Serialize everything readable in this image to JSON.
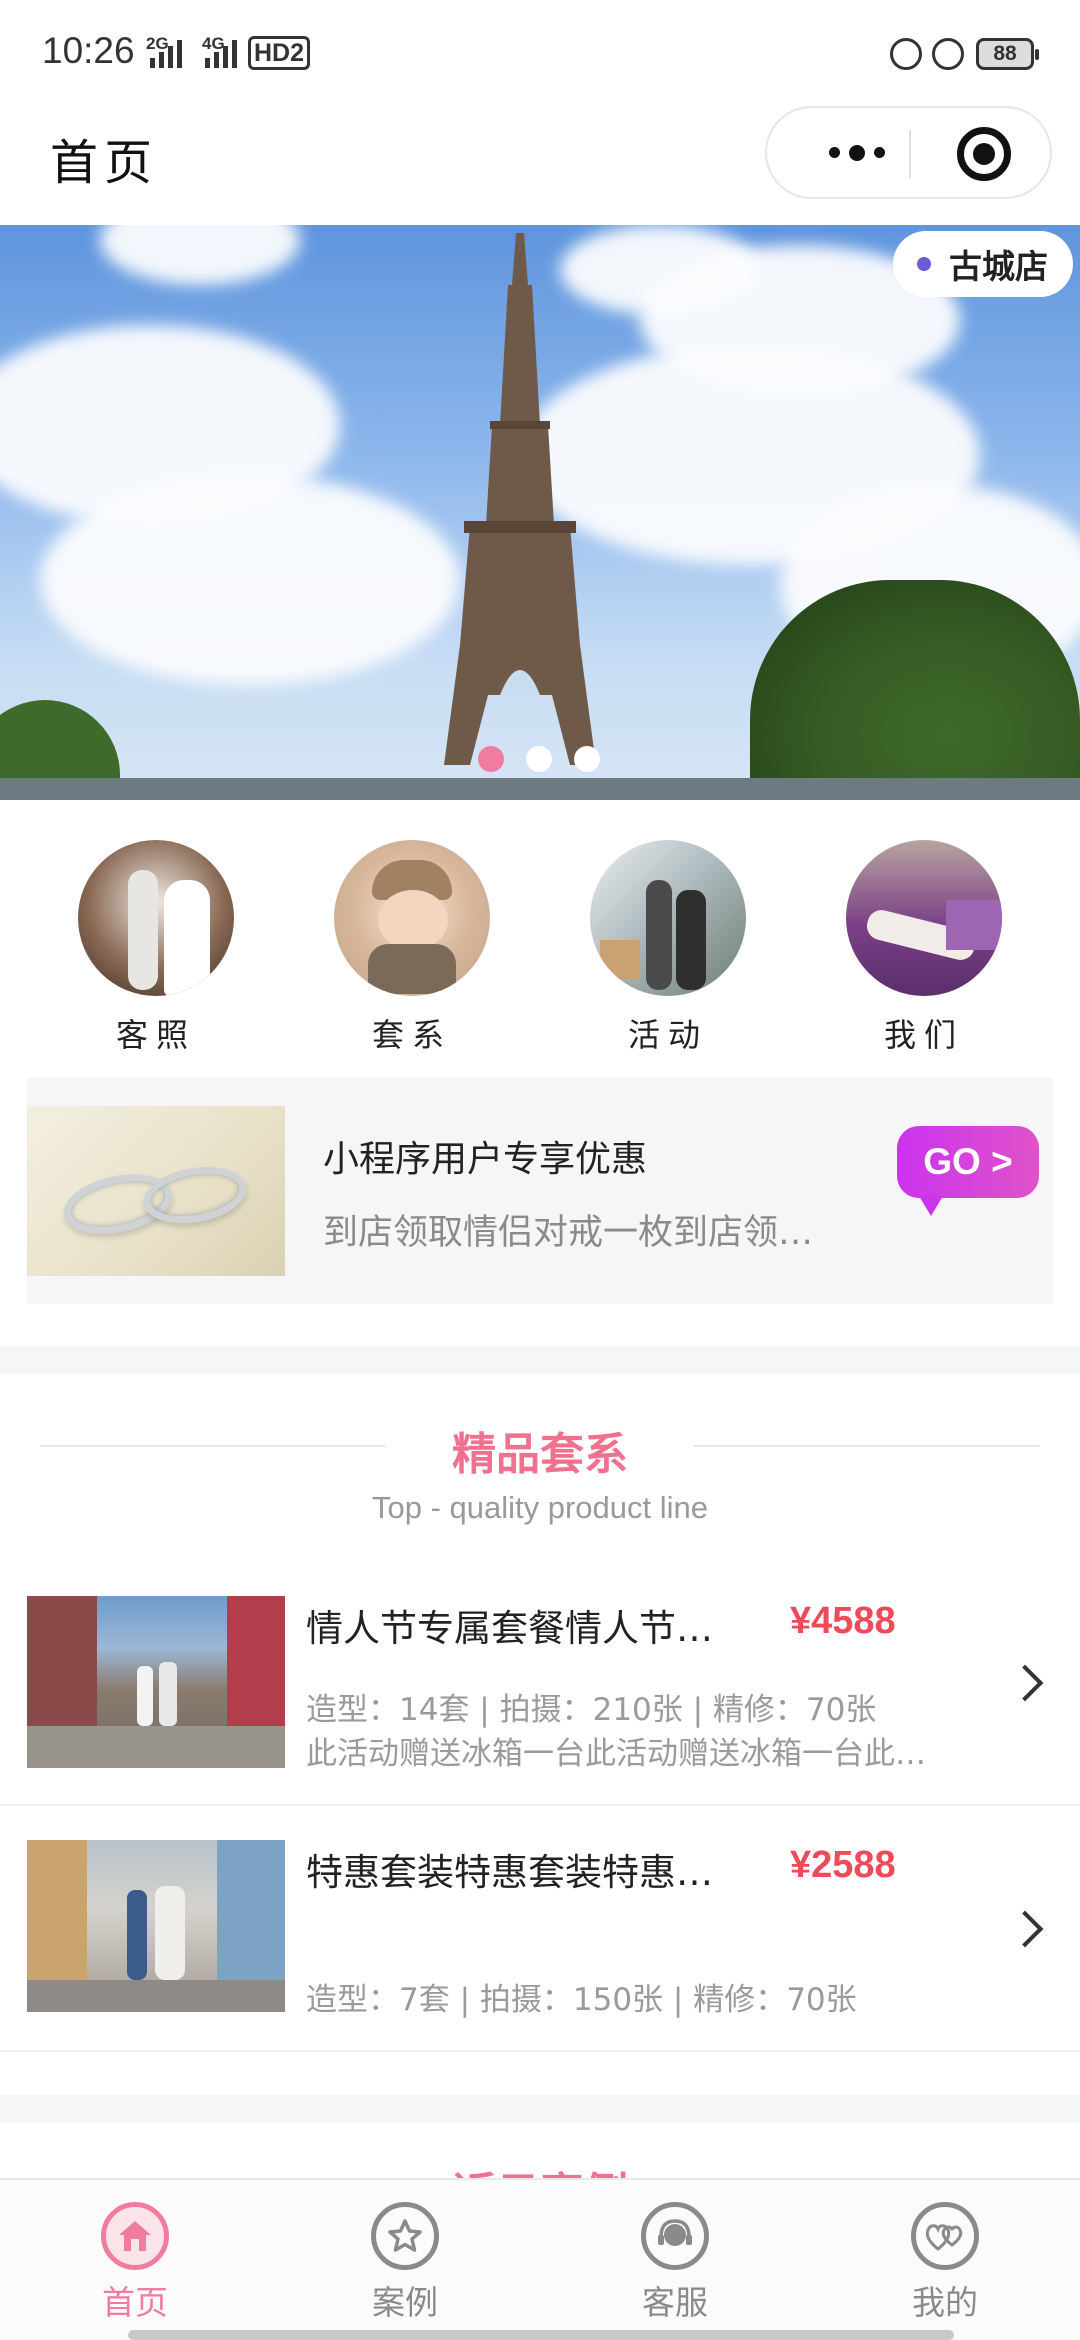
{
  "status_bar": {
    "time": "10:26",
    "net1": "2G",
    "net2": "4G",
    "hd": "HD2",
    "battery": "88"
  },
  "navbar": {
    "title": "首页"
  },
  "banner": {
    "store_label": "古城店",
    "slide_count": 3,
    "active_slide": 0
  },
  "categories": [
    {
      "label": "客照"
    },
    {
      "label": "套系"
    },
    {
      "label": "活动"
    },
    {
      "label": "我们"
    }
  ],
  "promo": {
    "title": "小程序用户专享优惠",
    "subtitle": "到店领取情侣对戒一枚到店领…",
    "badge": "GO >"
  },
  "section": {
    "title": "精品套系",
    "subtitle": "Top - quality product line"
  },
  "packages": [
    {
      "name": "情人节专属套餐情人节…",
      "price": "¥4588",
      "spec": "造型：14套 | 拍摄：210张 | 精修：70张",
      "note": "此活动赠送冰箱一台此活动赠送冰箱一台此…"
    },
    {
      "name": "特惠套装特惠套装特惠…",
      "price": "¥2588",
      "spec": "造型：7套 | 拍摄：150张 | 精修：70张",
      "note": ""
    }
  ],
  "section2": {
    "title": "近日案例"
  },
  "tabbar": [
    {
      "label": "首页",
      "icon": "home-icon",
      "active": true
    },
    {
      "label": "案例",
      "icon": "star-icon",
      "active": false
    },
    {
      "label": "客服",
      "icon": "headset-icon",
      "active": false
    },
    {
      "label": "我的",
      "icon": "hearts-icon",
      "active": false
    }
  ],
  "colors": {
    "accent": "#f07d9e",
    "price": "#ef4a5a",
    "section_title": "#f07090"
  }
}
